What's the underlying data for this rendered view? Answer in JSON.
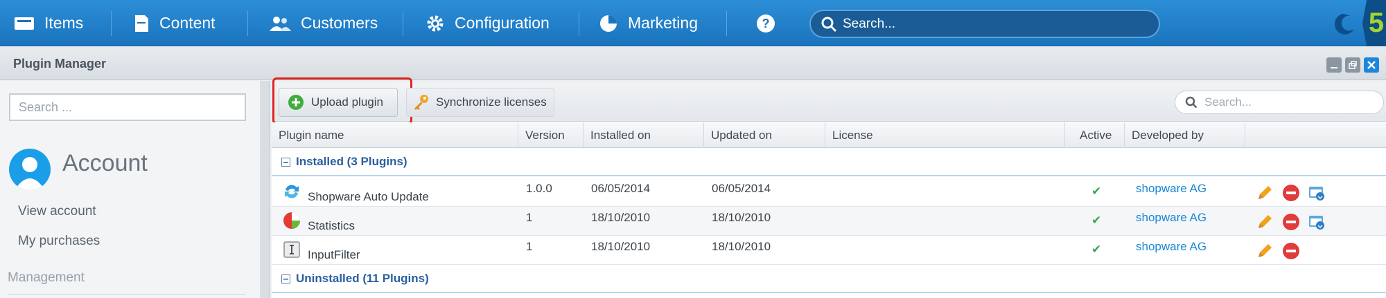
{
  "nav": {
    "items": [
      {
        "label": "Items",
        "icon": "items-icon"
      },
      {
        "label": "Content",
        "icon": "content-icon"
      },
      {
        "label": "Customers",
        "icon": "customers-icon"
      },
      {
        "label": "Configuration",
        "icon": "gear-icon"
      },
      {
        "label": "Marketing",
        "icon": "pie-chart-icon"
      }
    ],
    "help_icon": "help-icon",
    "search_placeholder": "Search..."
  },
  "window": {
    "title": "Plugin Manager"
  },
  "sidebar": {
    "search_placeholder": "Search ...",
    "account_title": "Account",
    "links": [
      "View account",
      "My purchases"
    ],
    "section": "Management"
  },
  "toolbar": {
    "upload_label": "Upload plugin",
    "sync_label": "Synchronize licenses",
    "search_placeholder": "Search..."
  },
  "grid": {
    "columns": [
      "Plugin name",
      "Version",
      "Installed on",
      "Updated on",
      "License",
      "Active",
      "Developed by"
    ],
    "installed_group": "Installed (3 Plugins)",
    "uninstalled_group": "Uninstalled (11 Plugins)",
    "rows": [
      {
        "name": "Shopware Auto Update",
        "version": "1.0.0",
        "installed": "06/05/2014",
        "updated": "06/05/2014",
        "license": "",
        "active": "✔",
        "developer": "shopware AG"
      },
      {
        "name": "Statistics",
        "version": "1",
        "installed": "18/10/2010",
        "updated": "18/10/2010",
        "license": "",
        "active": "✔",
        "developer": "shopware AG"
      },
      {
        "name": "InputFilter",
        "version": "1",
        "installed": "18/10/2010",
        "updated": "18/10/2010",
        "license": "",
        "active": "✔",
        "developer": "shopware AG"
      }
    ]
  },
  "colors": {
    "nav_blue": "#1a73bd",
    "highlight_red": "#e0251f",
    "link_blue": "#1a87d6",
    "check_green": "#35a54a"
  }
}
